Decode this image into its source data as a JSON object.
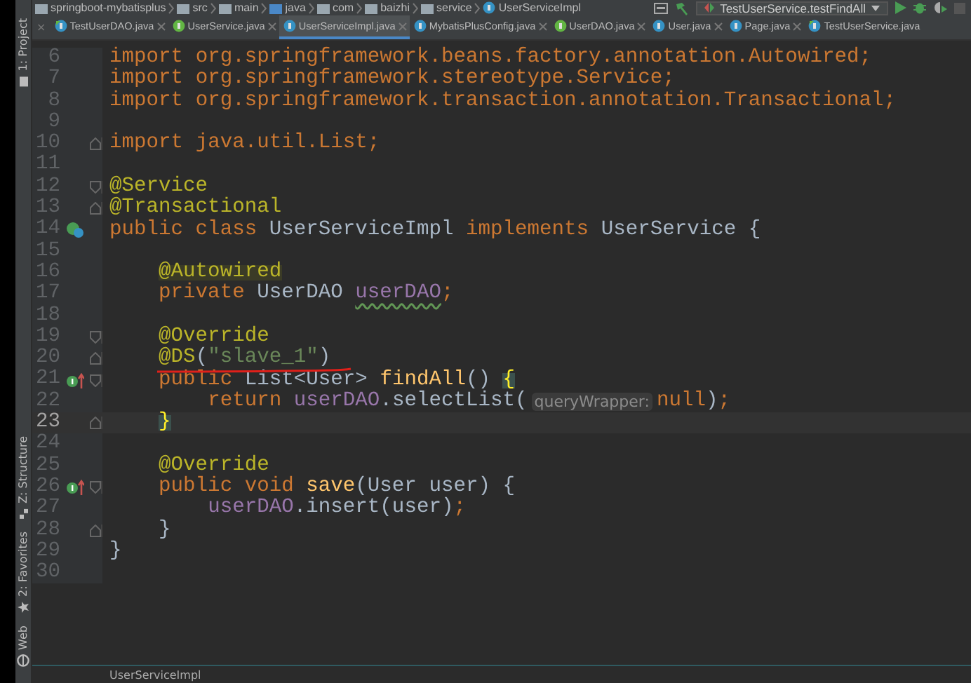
{
  "breadcrumb": [
    "springboot-mybatisplus",
    "src",
    "main",
    "java",
    "com",
    "baizhi",
    "service",
    "UserServiceImpl"
  ],
  "run_config": "TestUserService.testFindAll",
  "tabs_close_left": "×",
  "tabs": [
    {
      "label": "TestUserDAO.java",
      "kind": "test",
      "selected": false
    },
    {
      "label": "UserService.java",
      "kind": "interface",
      "selected": false
    },
    {
      "label": "UserServiceImpl.java",
      "kind": "class",
      "selected": true
    },
    {
      "label": "MybatisPlusConfig.java",
      "kind": "class",
      "selected": false
    },
    {
      "label": "UserDAO.java",
      "kind": "interface",
      "selected": false
    },
    {
      "label": "User.java",
      "kind": "class",
      "selected": false
    },
    {
      "label": "Page.java",
      "kind": "class",
      "selected": false
    },
    {
      "label": "TestUserService.java",
      "kind": "test",
      "selected": false
    }
  ],
  "side_tools": [
    {
      "label": "1: Project",
      "kind": "folder"
    },
    {
      "label": "Z: Structure",
      "kind": "structure"
    },
    {
      "label": "2: Favorites",
      "kind": "star"
    },
    {
      "label": "Web",
      "kind": "globe"
    }
  ],
  "lines": [
    {
      "number": "6",
      "kind": "plain",
      "current": false,
      "fold_start": false,
      "fold_end": false,
      "tokens": [
        {
          "kind": "keyword",
          "text": "import"
        },
        {
          "kind": "import_path",
          "text": " org.springframework.beans.factory.annotation.Autowired;"
        }
      ]
    },
    {
      "number": "7",
      "kind": "plain",
      "current": false,
      "fold_start": false,
      "fold_end": false,
      "tokens": [
        {
          "kind": "keyword",
          "text": "import"
        },
        {
          "kind": "import_path",
          "text": " org.springframework.stereotype.Service;"
        }
      ]
    },
    {
      "number": "8",
      "kind": "plain",
      "current": false,
      "fold_start": false,
      "fold_end": false,
      "tokens": [
        {
          "kind": "keyword",
          "text": "import"
        },
        {
          "kind": "import_path",
          "text": " org.springframework.transaction.annotation.Transactional;"
        }
      ]
    },
    {
      "number": "9",
      "kind": "plain",
      "current": false,
      "fold_start": false,
      "fold_end": false
    },
    {
      "number": "10",
      "kind": "plain",
      "current": false,
      "fold_start": false,
      "fold_end": true,
      "tokens": [
        {
          "kind": "keyword",
          "text": "import"
        },
        {
          "kind": "import_path",
          "text": " java.util.List;"
        }
      ]
    },
    {
      "number": "11",
      "kind": "plain",
      "current": false,
      "fold_start": false,
      "fold_end": false
    },
    {
      "number": "12",
      "kind": "plain",
      "current": false,
      "fold_start": true,
      "fold_end": false,
      "tokens": [
        {
          "kind": "annotation",
          "text": "@Service"
        }
      ]
    },
    {
      "number": "13",
      "kind": "plain",
      "current": false,
      "fold_start": false,
      "fold_end": true,
      "tokens": [
        {
          "kind": "annotation",
          "text": "@Transactional"
        }
      ]
    },
    {
      "number": "14",
      "kind": "class",
      "current": false,
      "fold_start": false,
      "fold_end": false,
      "tokens": [
        {
          "kind": "keyword",
          "text": "public class "
        },
        {
          "kind": "plain",
          "text": "UserServiceImpl "
        },
        {
          "kind": "keyword",
          "text": "implements "
        },
        {
          "kind": "plain",
          "text": "UserService {"
        }
      ]
    },
    {
      "number": "15",
      "kind": "plain",
      "current": false,
      "fold_start": false,
      "fold_end": false
    },
    {
      "number": "16",
      "kind": "plain",
      "current": false,
      "fold_start": false,
      "fold_end": false,
      "tokens": [
        {
          "kind": "annotation_marked",
          "text": "    @Autowired"
        }
      ]
    },
    {
      "number": "17",
      "kind": "plain",
      "current": false,
      "fold_start": false,
      "fold_end": false,
      "tokens": [
        {
          "kind": "keyword",
          "text": "    private "
        },
        {
          "kind": "plain",
          "text": "UserDAO "
        },
        {
          "kind": "field_warning",
          "text": "userDAO"
        },
        {
          "kind": "keyword",
          "text": ";"
        }
      ]
    },
    {
      "number": "18",
      "kind": "plain",
      "current": false,
      "fold_start": false,
      "fold_end": false
    },
    {
      "number": "19",
      "kind": "plain",
      "current": false,
      "fold_start": true,
      "fold_end": false,
      "tokens": [
        {
          "kind": "annotation",
          "text": "    @Override"
        }
      ]
    },
    {
      "number": "20",
      "kind": "plain",
      "current": false,
      "fold_start": false,
      "fold_end": true,
      "tokens": [
        {
          "kind": "annotation",
          "text": "    @DS"
        },
        {
          "kind": "plain",
          "text": "("
        },
        {
          "kind": "string",
          "text": "\"slave_1\""
        },
        {
          "kind": "plain",
          "text": ")"
        }
      ]
    },
    {
      "number": "21",
      "kind": "implements",
      "current": false,
      "fold_start": true,
      "fold_end": false,
      "tokens": [
        {
          "kind": "keyword",
          "text": "    public "
        },
        {
          "kind": "plain",
          "text": "List<User> "
        },
        {
          "kind": "method",
          "text": "findAll"
        },
        {
          "kind": "plain",
          "text": "() "
        },
        {
          "kind": "brace_match",
          "text": "{"
        }
      ]
    },
    {
      "number": "22",
      "kind": "plain",
      "current": false,
      "fold_start": false,
      "fold_end": false,
      "tokens": [
        {
          "kind": "keyword",
          "text": "        return "
        },
        {
          "kind": "field",
          "text": "userDAO"
        },
        {
          "kind": "plain",
          "text": ".selectList("
        },
        {
          "kind": "hint",
          "text": "queryWrapper:"
        },
        {
          "kind": "keyword",
          "text": "null"
        },
        {
          "kind": "plain",
          "text": ")"
        },
        {
          "kind": "keyword",
          "text": ";"
        }
      ]
    },
    {
      "number": "23",
      "kind": "plain",
      "current": true,
      "fold_start": false,
      "fold_end": true,
      "tokens": [
        {
          "kind": "brace_match",
          "text": "    }"
        }
      ]
    },
    {
      "number": "24",
      "kind": "plain",
      "current": false,
      "fold_start": false,
      "fold_end": false
    },
    {
      "number": "25",
      "kind": "plain",
      "current": false,
      "fold_start": false,
      "fold_end": false,
      "tokens": [
        {
          "kind": "annotation",
          "text": "    @Override"
        }
      ]
    },
    {
      "number": "26",
      "kind": "implements",
      "current": false,
      "fold_start": true,
      "fold_end": false,
      "tokens": [
        {
          "kind": "keyword",
          "text": "    public void "
        },
        {
          "kind": "method",
          "text": "save"
        },
        {
          "kind": "plain",
          "text": "(User user) {"
        }
      ]
    },
    {
      "number": "27",
      "kind": "plain",
      "current": false,
      "fold_start": false,
      "fold_end": false,
      "tokens": [
        {
          "kind": "field",
          "text": "        userDAO"
        },
        {
          "kind": "plain",
          "text": ".insert(user)"
        },
        {
          "kind": "keyword",
          "text": ";"
        }
      ]
    },
    {
      "number": "28",
      "kind": "plain",
      "current": false,
      "fold_start": false,
      "fold_end": true,
      "tokens": [
        {
          "kind": "plain",
          "text": "    }"
        }
      ]
    },
    {
      "number": "29",
      "kind": "plain",
      "current": false,
      "fold_start": false,
      "fold_end": false,
      "tokens": [
        {
          "kind": "plain",
          "text": "}"
        }
      ]
    },
    {
      "number": "30",
      "kind": "plain",
      "current": false,
      "fold_start": false,
      "fold_end": false
    }
  ],
  "status_breadcrumb": "UserServiceImpl"
}
